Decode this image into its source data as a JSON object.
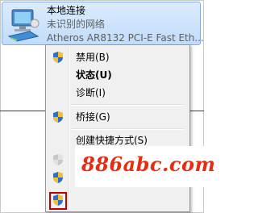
{
  "adapter": {
    "name": "本地连接",
    "status": "未识别的网络",
    "device": "Atheros AR8132 PCI-E Fast Eth...",
    "icon": "network-adapter-icon"
  },
  "menu": {
    "items": [
      {
        "label": "禁用(B)",
        "icon": "uac-shield-icon",
        "bold": false,
        "disabled": false
      },
      {
        "label": "状态(U)",
        "icon": "",
        "bold": true,
        "disabled": false
      },
      {
        "label": "诊断(I)",
        "icon": "",
        "bold": false,
        "disabled": false
      },
      {
        "label": "桥接(G)",
        "icon": "uac-shield-icon",
        "bold": false,
        "disabled": false
      },
      {
        "label": "创建快捷方式(S)",
        "icon": "",
        "bold": false,
        "disabled": false
      },
      {
        "label": "",
        "icon": "uac-shield-icon",
        "bold": false,
        "disabled": true
      },
      {
        "label": "",
        "icon": "uac-shield-icon",
        "bold": false,
        "disabled": false
      },
      {
        "label": "",
        "icon": "uac-shield-icon",
        "bold": false,
        "disabled": false,
        "highlighted": true
      }
    ]
  },
  "watermark": {
    "text": "886abc.com",
    "color": "#e52d12"
  },
  "colors": {
    "annotation_red": "#c00000",
    "selection_blue": "#c1dcfc"
  }
}
